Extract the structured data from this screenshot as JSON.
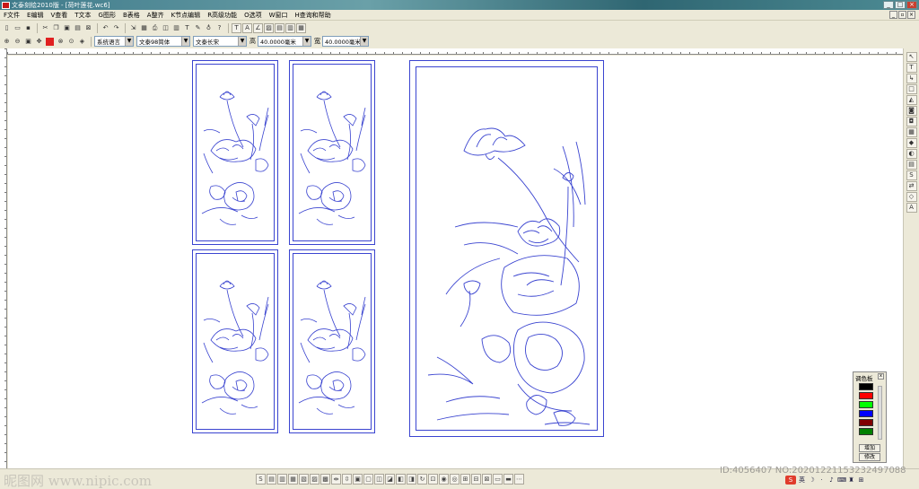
{
  "window": {
    "title": "文泰刻绘2010版 - [荷叶莲花.wc6]"
  },
  "menu": [
    "F文件",
    "E编辑",
    "V查看",
    "T文本",
    "G图形",
    "B表格",
    "A整齐",
    "K节点编辑",
    "R高级功能",
    "O选项",
    "W窗口",
    "H查询和帮助"
  ],
  "format_bar": {
    "language": "系统语言",
    "cn_font": "文泰98简体",
    "en_font": "文泰长宋",
    "height_label": "高",
    "height_value": "40.0000毫米",
    "width_label": "宽",
    "width_value": "40.0000毫米"
  },
  "palette": {
    "title": "调色板",
    "close": "x",
    "colors": [
      "#000000",
      "#ff0000",
      "#00ff00",
      "#0000ff",
      "#800000",
      "#008000"
    ],
    "add_label": "增加",
    "edit_label": "修改"
  },
  "watermark": {
    "site": "昵图网 www.nipic.com",
    "id": "ID:4056407 NO:20201221153232497088"
  },
  "ime": {
    "logo": "S",
    "mode": "英"
  },
  "accent_color": "#3a44d0"
}
